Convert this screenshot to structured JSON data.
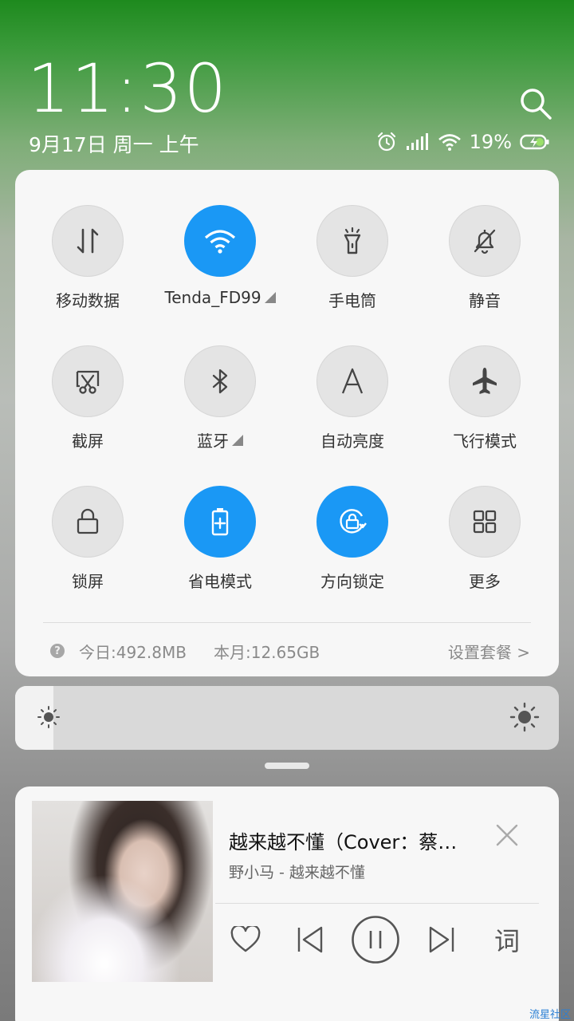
{
  "header": {
    "time": "11:30",
    "date": "9月17日 周一 上午",
    "battery_percent": "19%"
  },
  "toggles": [
    {
      "label": "移动数据",
      "icon": "mobile-data-icon",
      "on": false
    },
    {
      "label": "Tenda_FD99",
      "icon": "wifi-icon",
      "on": true
    },
    {
      "label": "手电筒",
      "icon": "flashlight-icon",
      "on": false
    },
    {
      "label": "静音",
      "icon": "mute-bell-icon",
      "on": false
    },
    {
      "label": "截屏",
      "icon": "screenshot-icon",
      "on": false
    },
    {
      "label": "蓝牙",
      "icon": "bluetooth-icon",
      "on": false
    },
    {
      "label": "自动亮度",
      "icon": "auto-brightness-icon",
      "on": false
    },
    {
      "label": "飞行模式",
      "icon": "airplane-icon",
      "on": false
    },
    {
      "label": "锁屏",
      "icon": "lock-icon",
      "on": false
    },
    {
      "label": "省电模式",
      "icon": "battery-saver-icon",
      "on": true
    },
    {
      "label": "方向锁定",
      "icon": "rotation-lock-icon",
      "on": true
    },
    {
      "label": "更多",
      "icon": "grid-icon",
      "on": false
    }
  ],
  "data_usage": {
    "today": "今日:492.8MB",
    "month": "本月:12.65GB",
    "plan_link": "设置套餐 >"
  },
  "brightness": {
    "level": 0.07
  },
  "music": {
    "title": "越来越不懂（Cover：蔡…",
    "subtitle": "野小马 - 越来越不懂",
    "lyrics_button": "词"
  },
  "watermark": "流星社区",
  "colors": {
    "accent": "#1a98f5"
  }
}
